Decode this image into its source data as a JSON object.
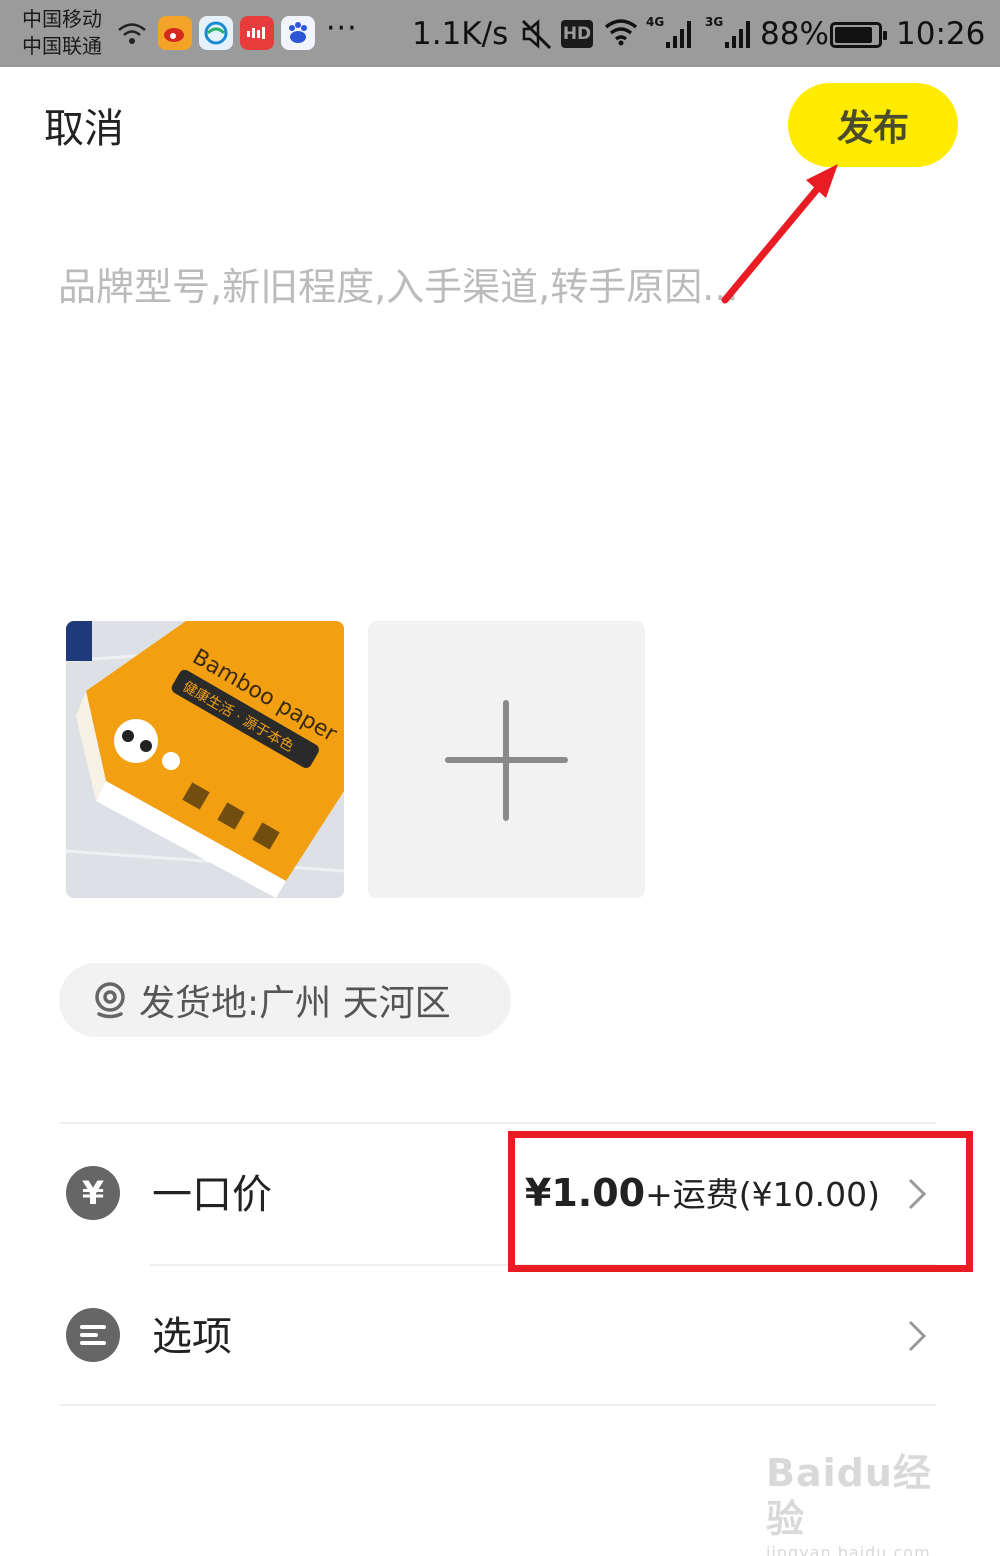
{
  "status_bar": {
    "carrier1": "中国移动",
    "carrier2": "中国联通",
    "more": "···",
    "net_speed": "1.1K/s",
    "hd_label": "HD",
    "signal1_label": "4G",
    "signal2_label": "3G",
    "battery_pct": "88%",
    "battery_level": 0.88,
    "time": "10:26"
  },
  "header": {
    "cancel_label": "取消",
    "publish_label": "发布"
  },
  "description": {
    "placeholder": "品牌型号,新旧程度,入手渠道,转手原因...",
    "value": ""
  },
  "photos": {
    "product_text": "Bamboo paper",
    "product_subtext": "健康生活 · 源于本色"
  },
  "location": {
    "label": "发货地:广州 天河区"
  },
  "rows": [
    {
      "label": "一口价",
      "icon_glyph": "¥",
      "price_amount": "¥1.00",
      "price_extra": "+运费(¥10.00)"
    },
    {
      "label": "选项"
    }
  ],
  "watermark": {
    "top": "Baidu经验",
    "bottom": "jingyan.baidu.com"
  },
  "colors": {
    "publish_bg": "#ffeb00",
    "annotation_red": "#ea1c23",
    "status_bar_bg": "#9b9b9b"
  }
}
